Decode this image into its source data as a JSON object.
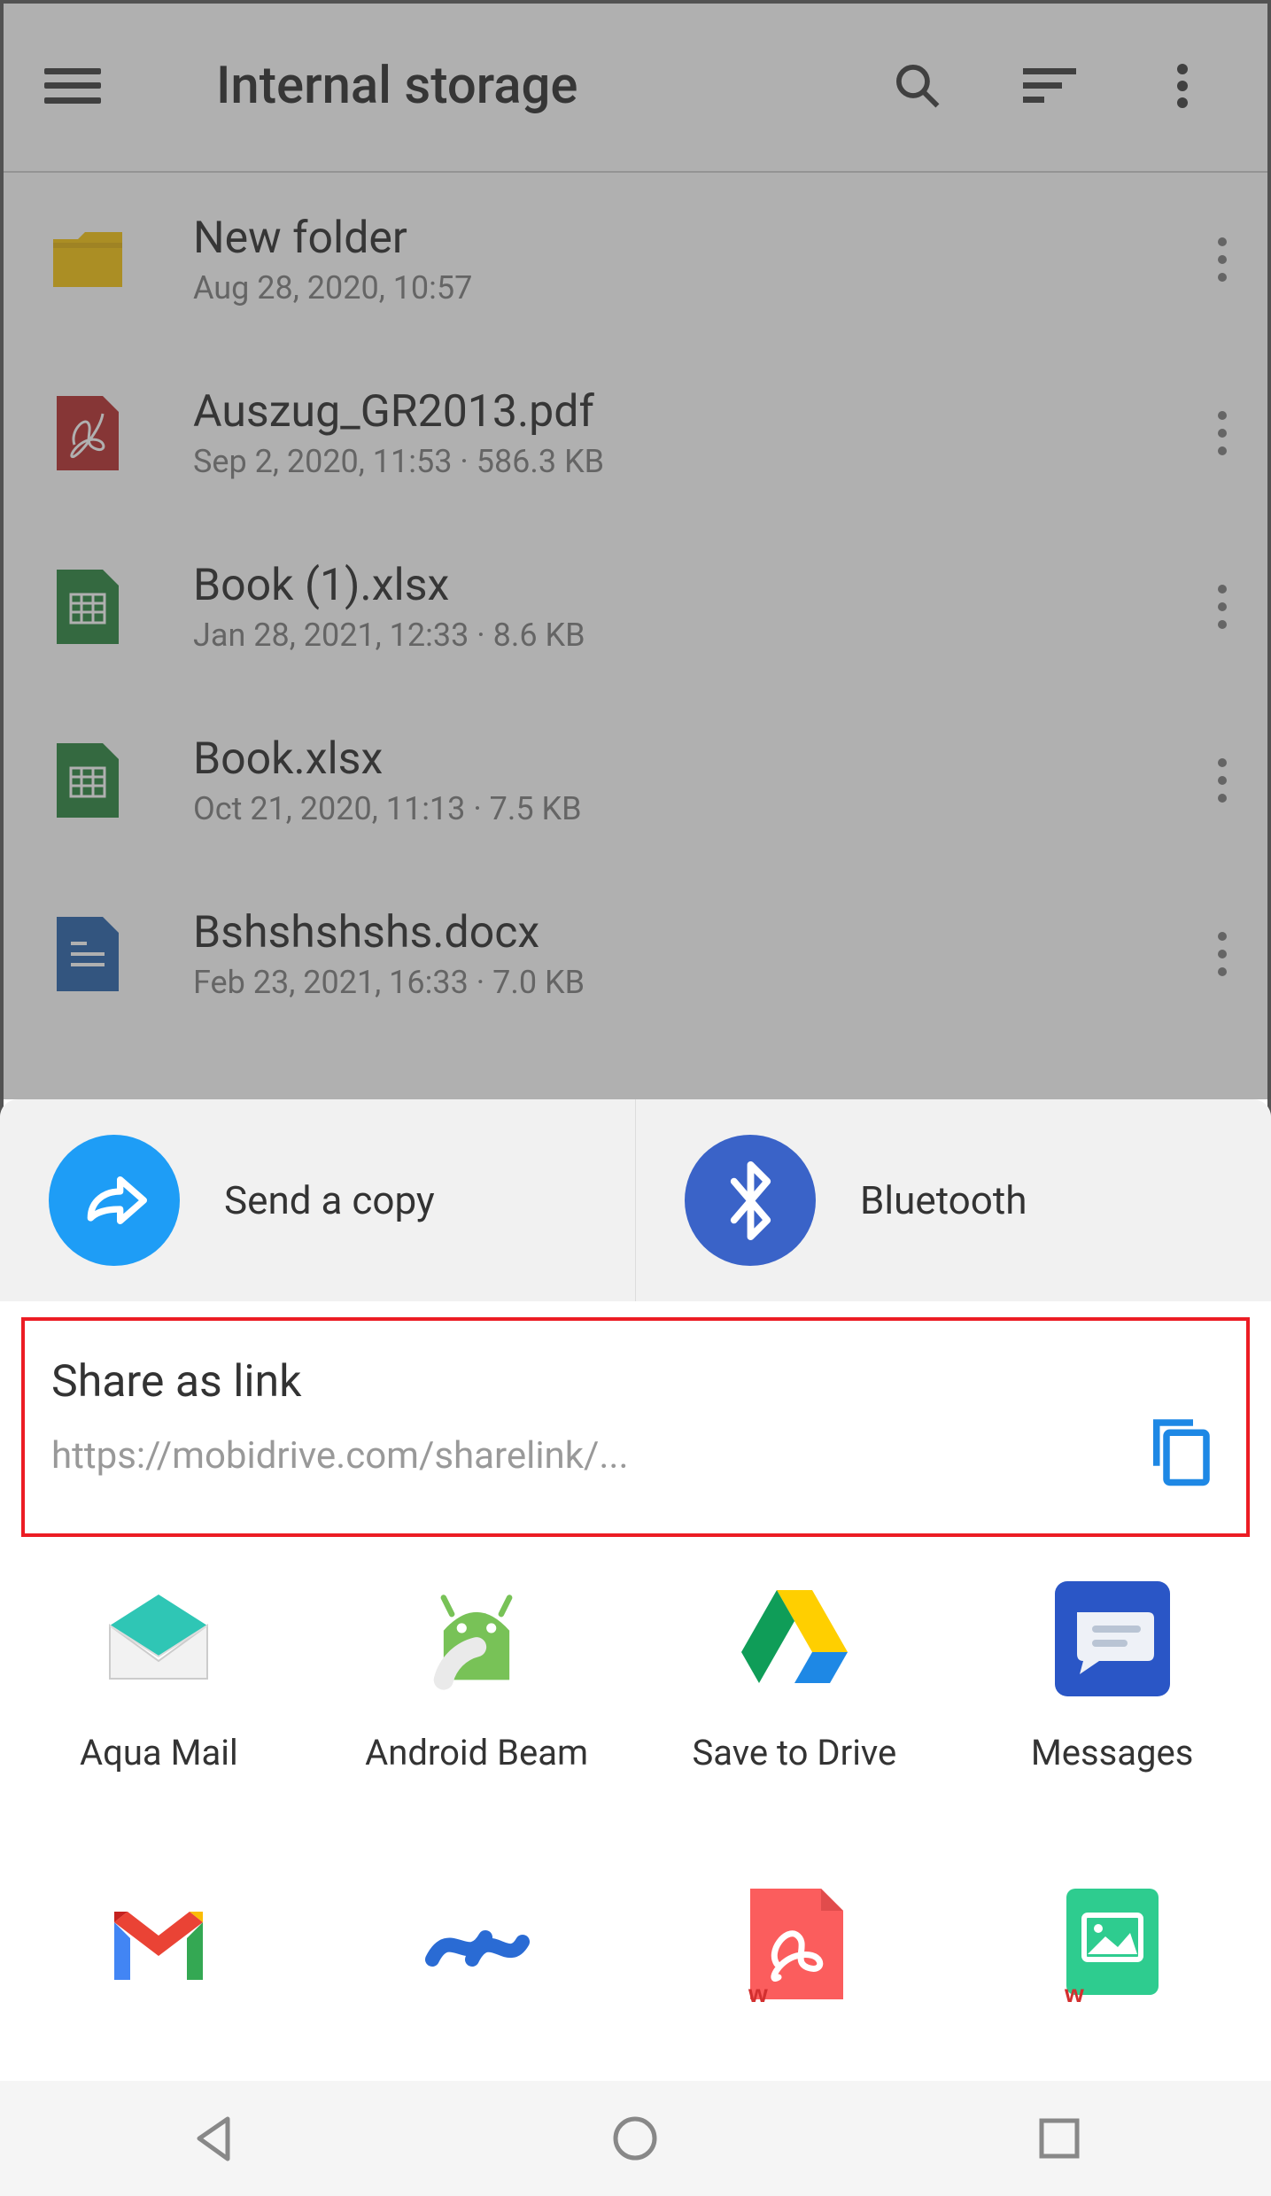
{
  "header": {
    "title": "Internal storage"
  },
  "files": [
    {
      "name": "New folder",
      "meta": "Aug 28, 2020, 10:57",
      "type": "folder"
    },
    {
      "name": "Auszug_GR2013.pdf",
      "meta": "Sep 2, 2020, 11:53  ·  586.3 KB",
      "type": "pdf"
    },
    {
      "name": "Book (1).xlsx",
      "meta": "Jan 28, 2021, 12:33  ·  8.6 KB",
      "type": "xlsx"
    },
    {
      "name": "Book.xlsx",
      "meta": "Oct 21, 2020, 11:13  ·  7.5 KB",
      "type": "xlsx"
    },
    {
      "name": "Bshshshshs.docx",
      "meta": "Feb 23, 2021, 16:33  ·  7.0 KB",
      "type": "docx"
    }
  ],
  "share": {
    "send_copy": "Send a copy",
    "bluetooth": "Bluetooth",
    "link_title": "Share as link",
    "link_url": "https://mobidrive.com/sharelink/..."
  },
  "apps": {
    "aqua_mail": "Aqua Mail",
    "android_beam": "Android Beam",
    "save_drive": "Save to Drive",
    "messages": "Messages"
  }
}
